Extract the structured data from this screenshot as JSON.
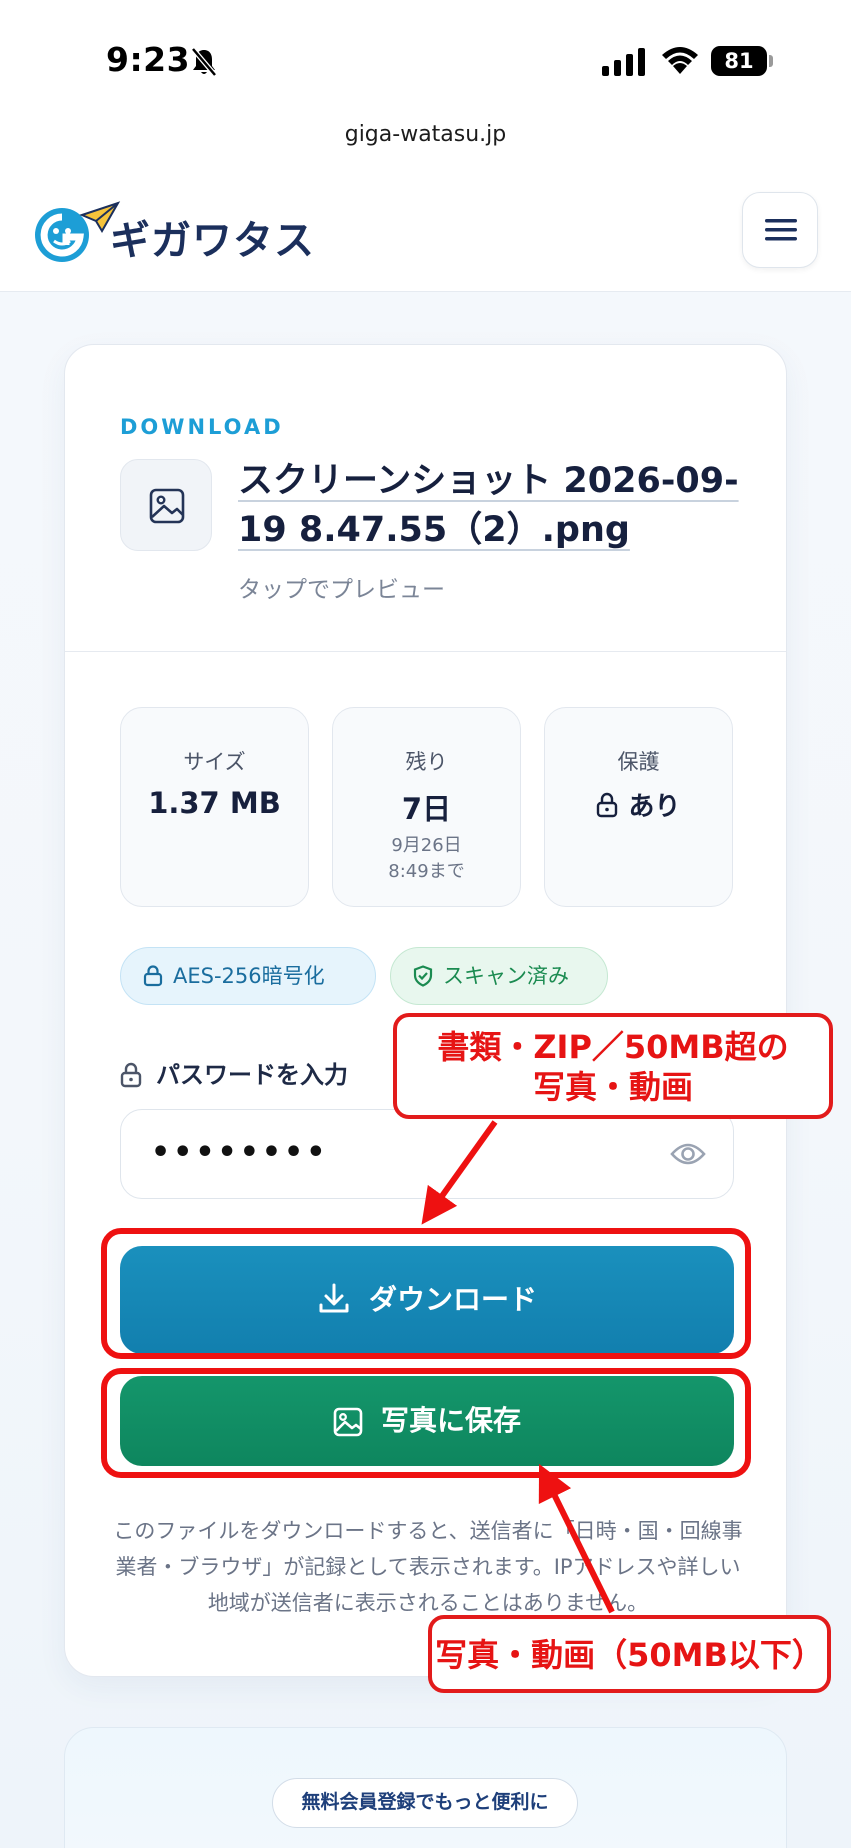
{
  "status_bar": {
    "time": "9:23",
    "battery": "81"
  },
  "url": "giga-watasu.jp",
  "header": {
    "logo_text": "ギガワタス"
  },
  "download_card": {
    "eyebrow": "DOWNLOAD",
    "file_name": "スクリーンショット 2026-09-19 8.47.55（2）.png",
    "preview_hint": "タップでプレビュー",
    "stats": [
      {
        "label": "サイズ",
        "value": "1.37 MB",
        "sub": ""
      },
      {
        "label": "残り",
        "value": "7日",
        "sub": "9月26日\n8:49まで"
      },
      {
        "label": "保護",
        "value": "あり",
        "sub": ""
      }
    ],
    "chips": {
      "encryption": "AES-256暗号化",
      "scan": "スキャン済み"
    },
    "password": {
      "label": "パスワードを入力",
      "value": "••••••••"
    },
    "buttons": {
      "download": "ダウンロード",
      "save_photo": "写真に保存"
    },
    "notice": "このファイルをダウンロードすると、送信者に「日時・国・回線事業者・ブラウザ」が記録として表示されます。IPアドレスや詳しい地域が送信者に表示されることはありません。"
  },
  "promo": {
    "pill": "無料会員登録でもっと便利に"
  },
  "annotations": {
    "top_line1": "書類・ZIP／50MB超の",
    "top_line2": "写真・動画",
    "bottom": "写真・動画（50MB以下）"
  },
  "colors": {
    "brand_blue": "#1a90bd",
    "brand_green": "#14966b",
    "annotation_red": "#e21b1b",
    "eyebrow": "#1d9ed6"
  },
  "icons": {
    "bell": "bell-slash-icon",
    "signal": "cellular-signal-icon",
    "wifi": "wifi-icon",
    "menu": "hamburger-menu-icon",
    "file": "image-file-icon",
    "lock": "lock-icon",
    "shield": "shield-check-icon",
    "eye": "eye-icon",
    "download": "download-icon",
    "photo": "photo-icon"
  }
}
